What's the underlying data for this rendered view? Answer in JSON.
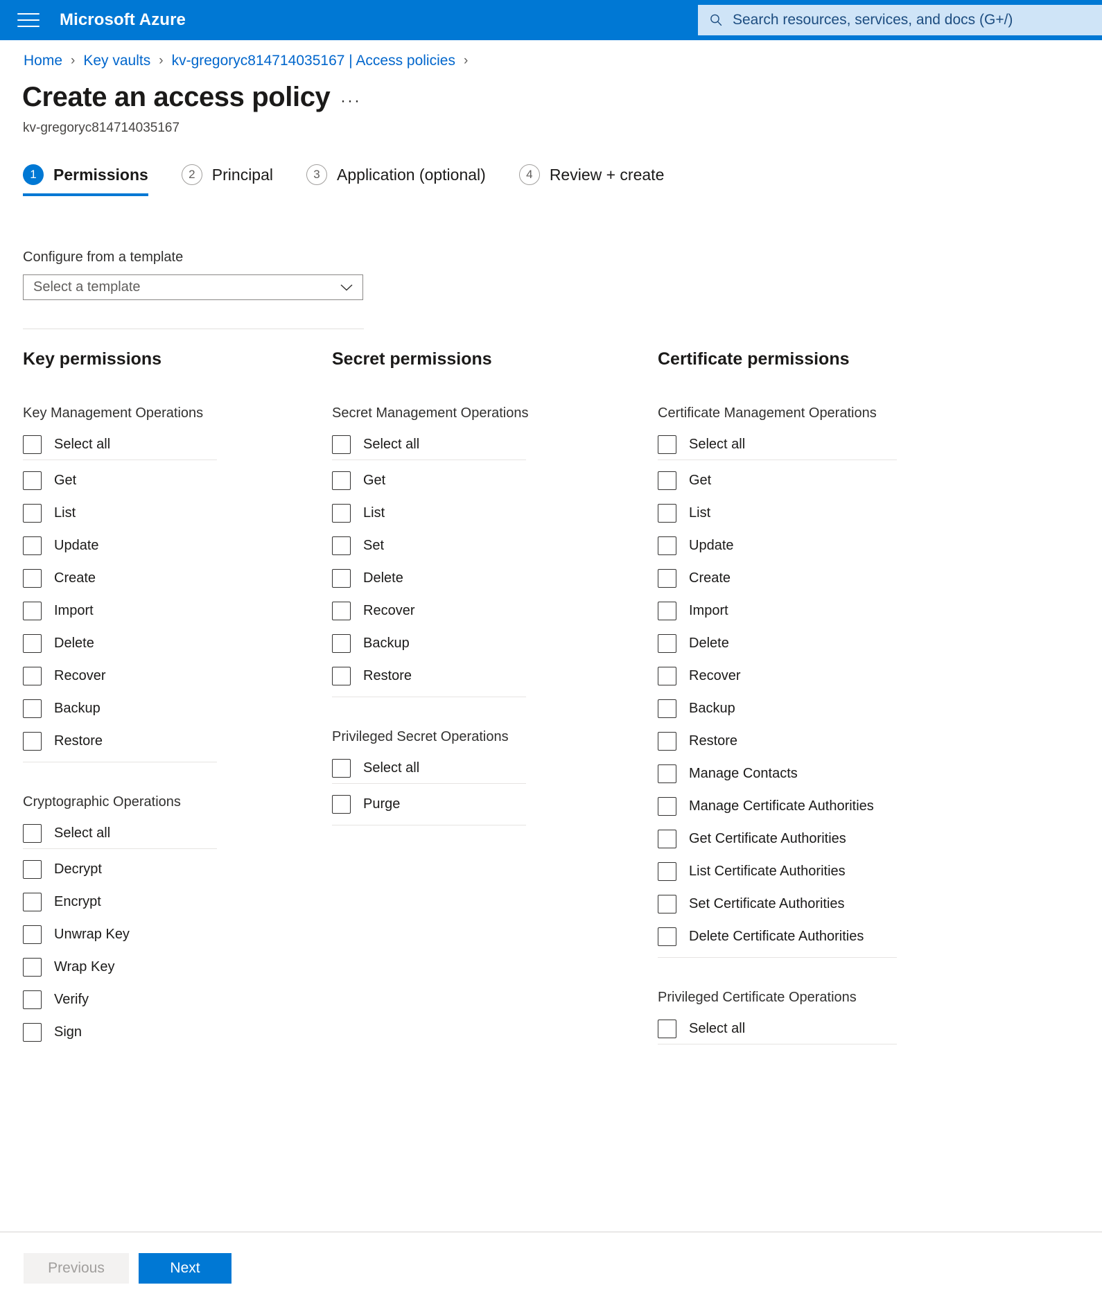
{
  "topbar": {
    "menu_icon": "hamburger-icon",
    "brand": "Microsoft Azure",
    "search_icon": "search-icon",
    "search_placeholder": "Search resources, services, and docs (G+/)",
    "background_color": "#0078d4"
  },
  "breadcrumb": {
    "items": [
      "Home",
      "Key vaults",
      "kv-gregoryc814714035167 | Access policies"
    ],
    "separator": "›",
    "link_color": "#0066cc"
  },
  "header": {
    "title": "Create an access policy",
    "ellipsis": "···",
    "subtitle": "kv-gregoryc814714035167"
  },
  "wizard": {
    "tabs": [
      {
        "number": "1",
        "label": "Permissions",
        "active": true
      },
      {
        "number": "2",
        "label": "Principal",
        "active": false
      },
      {
        "number": "3",
        "label": "Application (optional)",
        "active": false
      },
      {
        "number": "4",
        "label": "Review + create",
        "active": false
      }
    ],
    "accent_color": "#0078d4"
  },
  "template": {
    "label": "Configure from a template",
    "placeholder": "Select a template",
    "value": "",
    "chevron_icon": "chevron-down-icon"
  },
  "columns": {
    "key": {
      "title": "Key permissions",
      "groups": [
        {
          "title": "Key Management Operations",
          "select_all": "Select all",
          "items": [
            "Get",
            "List",
            "Update",
            "Create",
            "Import",
            "Delete",
            "Recover",
            "Backup",
            "Restore"
          ],
          "end_divider": true
        },
        {
          "title": "Cryptographic Operations",
          "select_all": "Select all",
          "items": [
            "Decrypt",
            "Encrypt",
            "Unwrap Key",
            "Wrap Key",
            "Verify",
            "Sign"
          ],
          "end_divider": false
        }
      ]
    },
    "secret": {
      "title": "Secret permissions",
      "groups": [
        {
          "title": "Secret Management Operations",
          "select_all": "Select all",
          "items": [
            "Get",
            "List",
            "Set",
            "Delete",
            "Recover",
            "Backup",
            "Restore"
          ],
          "end_divider": true
        },
        {
          "title": "Privileged Secret Operations",
          "select_all": "Select all",
          "items": [
            "Purge"
          ],
          "end_divider": true
        }
      ]
    },
    "certificate": {
      "title": "Certificate permissions",
      "groups": [
        {
          "title": "Certificate Management Operations",
          "select_all": "Select all",
          "items": [
            "Get",
            "List",
            "Update",
            "Create",
            "Import",
            "Delete",
            "Recover",
            "Backup",
            "Restore",
            "Manage Contacts",
            "Manage Certificate Authorities",
            "Get Certificate Authorities",
            "List Certificate Authorities",
            "Set Certificate Authorities",
            "Delete Certificate Authorities"
          ],
          "end_divider": true
        },
        {
          "title": "Privileged Certificate Operations",
          "select_all": "Select all",
          "items": [],
          "end_divider": false
        }
      ]
    }
  },
  "footer": {
    "previous_label": "Previous",
    "next_label": "Next",
    "next_color": "#0078d4"
  }
}
